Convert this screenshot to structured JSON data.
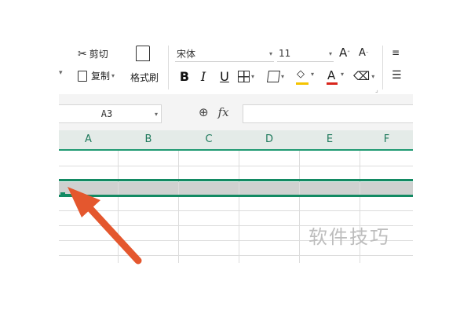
{
  "ribbon": {
    "cut_label": "剪切",
    "copy_label": "复制",
    "format_painter_label": "格式刷",
    "font_name": "宋体",
    "font_size": "11",
    "grow_font": "A",
    "shrink_font": "A",
    "bold": "B",
    "italic": "I",
    "underline": "U",
    "font_color_glyph": "A",
    "font_color": "#d9261c",
    "fill_color": "#f5c400"
  },
  "formula_bar": {
    "cell_reference": "A3",
    "fx_label": "fx",
    "formula_value": ""
  },
  "sheet": {
    "columns": [
      "A",
      "B",
      "C",
      "D",
      "E",
      "F"
    ],
    "selected_row": 3,
    "accent_color": "#138a63"
  },
  "watermark": "软件技巧"
}
